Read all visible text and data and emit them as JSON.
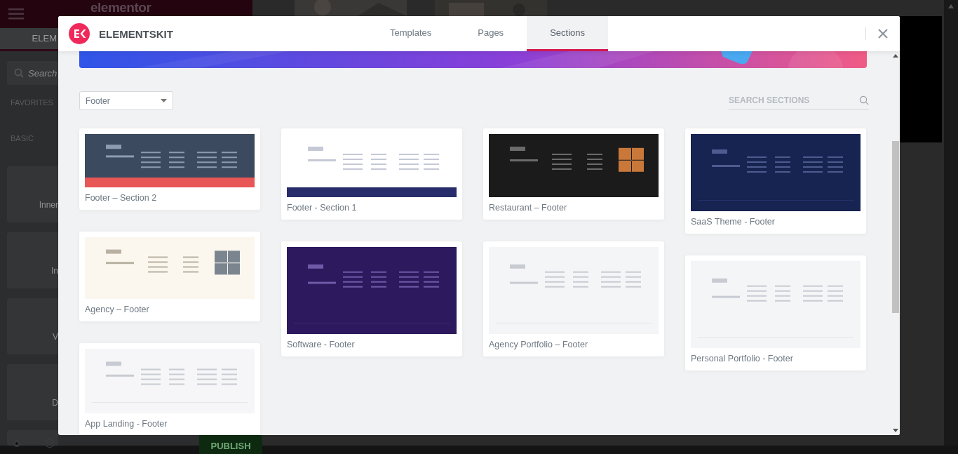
{
  "editor": {
    "logo": "elementor",
    "panel_tab": "ELEM",
    "search": {
      "placeholder": "Search"
    },
    "categories": [
      {
        "label": "FAVORITES"
      },
      {
        "label": "BASIC"
      }
    ],
    "widgets": [
      {
        "label": "Inner"
      },
      {
        "label": "In"
      },
      {
        "label": "V"
      },
      {
        "label": "D"
      }
    ],
    "publish": "PUBLISH"
  },
  "modal": {
    "brand": "ELEMENTSKIT",
    "tabs": [
      {
        "label": "Templates",
        "selected": false
      },
      {
        "label": "Pages",
        "selected": false
      },
      {
        "label": "Sections",
        "selected": true
      }
    ],
    "filter": {
      "value": "Footer"
    },
    "search": {
      "placeholder": "SEARCH SECTIONS"
    },
    "columns": [
      {
        "cards": [
          {
            "title": "Footer – Section 2"
          },
          {
            "title": "Agency – Footer"
          },
          {
            "title": "App Landing - Footer"
          }
        ]
      },
      {
        "cards": [
          {
            "title": "Footer - Section 1"
          },
          {
            "title": "Software - Footer"
          }
        ]
      },
      {
        "cards": [
          {
            "title": "Restaurant – Footer"
          },
          {
            "title": "Agency Portfolio – Footer"
          }
        ]
      },
      {
        "cards": [
          {
            "title": "SaaS Theme - Footer"
          },
          {
            "title": "Personal Portfolio - Footer"
          }
        ]
      }
    ]
  }
}
